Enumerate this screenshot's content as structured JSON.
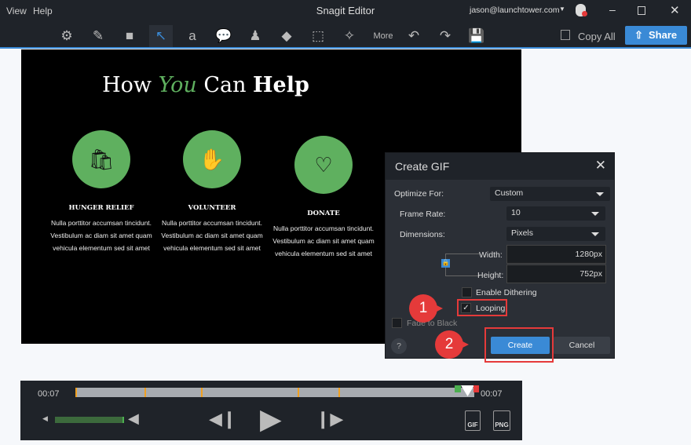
{
  "titlebar": {
    "menu": [
      "View",
      "Help"
    ],
    "title": "Snagit Editor",
    "account": "jason@launchtower.com"
  },
  "toolbar": {
    "tools": [
      {
        "name": "effects-icon",
        "glyph": "⚙"
      },
      {
        "name": "pen-icon",
        "glyph": "✎"
      },
      {
        "name": "shape-icon",
        "glyph": "■"
      },
      {
        "name": "arrow-icon",
        "glyph": "↖"
      },
      {
        "name": "text-icon",
        "glyph": "a"
      },
      {
        "name": "callout-icon",
        "glyph": "💬"
      },
      {
        "name": "stamp-icon",
        "glyph": "♟"
      },
      {
        "name": "fill-icon",
        "glyph": "◆"
      },
      {
        "name": "selection-icon",
        "glyph": "⬚"
      },
      {
        "name": "magic-wand-icon",
        "glyph": "✧"
      }
    ],
    "more": "More",
    "copy_all": "Copy All",
    "share": "Share",
    "accent": "#3a8ad6"
  },
  "canvas": {
    "title_parts": [
      "How ",
      "You",
      " Can ",
      "Help"
    ],
    "columns": [
      {
        "title": "HUNGER RELIEF",
        "icon": "bag-icon",
        "glyph": "🛍",
        "text": "Nulla porttitor accumsan tincidunt. Vestibulum ac diam sit amet quam vehicula elementum sed sit amet"
      },
      {
        "title": "VOLUNTEER",
        "icon": "hand-heart-icon",
        "glyph": "✋",
        "text": "Nulla porttitor accumsan tincidunt. Vestibulum ac diam sit amet quam vehicula elementum sed sit amet"
      },
      {
        "title": "DONATE",
        "icon": "heart-coin-icon",
        "glyph": "♡",
        "text": "Nulla porttitor accumsan tincidunt. Vestibulum ac diam sit amet quam vehicula elementum sed sit amet"
      }
    ],
    "green": "#5fb05f"
  },
  "dialog": {
    "title": "Create GIF",
    "optimize_label": "Optimize For:",
    "optimize_value": "Custom",
    "frame_rate_label": "Frame Rate:",
    "frame_rate_value": "10",
    "dimensions_label": "Dimensions:",
    "dimensions_value": "Pixels",
    "width_label": "Width:",
    "width_value": "1280px",
    "height_label": "Height:",
    "height_value": "752px",
    "dithering": {
      "label": "Enable Dithering",
      "checked": false
    },
    "looping": {
      "label": "Looping",
      "checked": true
    },
    "fade": {
      "label": "Fade to Black",
      "checked": false
    },
    "help": "?",
    "create": "Create",
    "cancel": "Cancel",
    "callouts": [
      "1",
      "2"
    ]
  },
  "player": {
    "time_start": "00:07",
    "time_end": "00:07",
    "gif": "GIF",
    "png": "PNG"
  }
}
